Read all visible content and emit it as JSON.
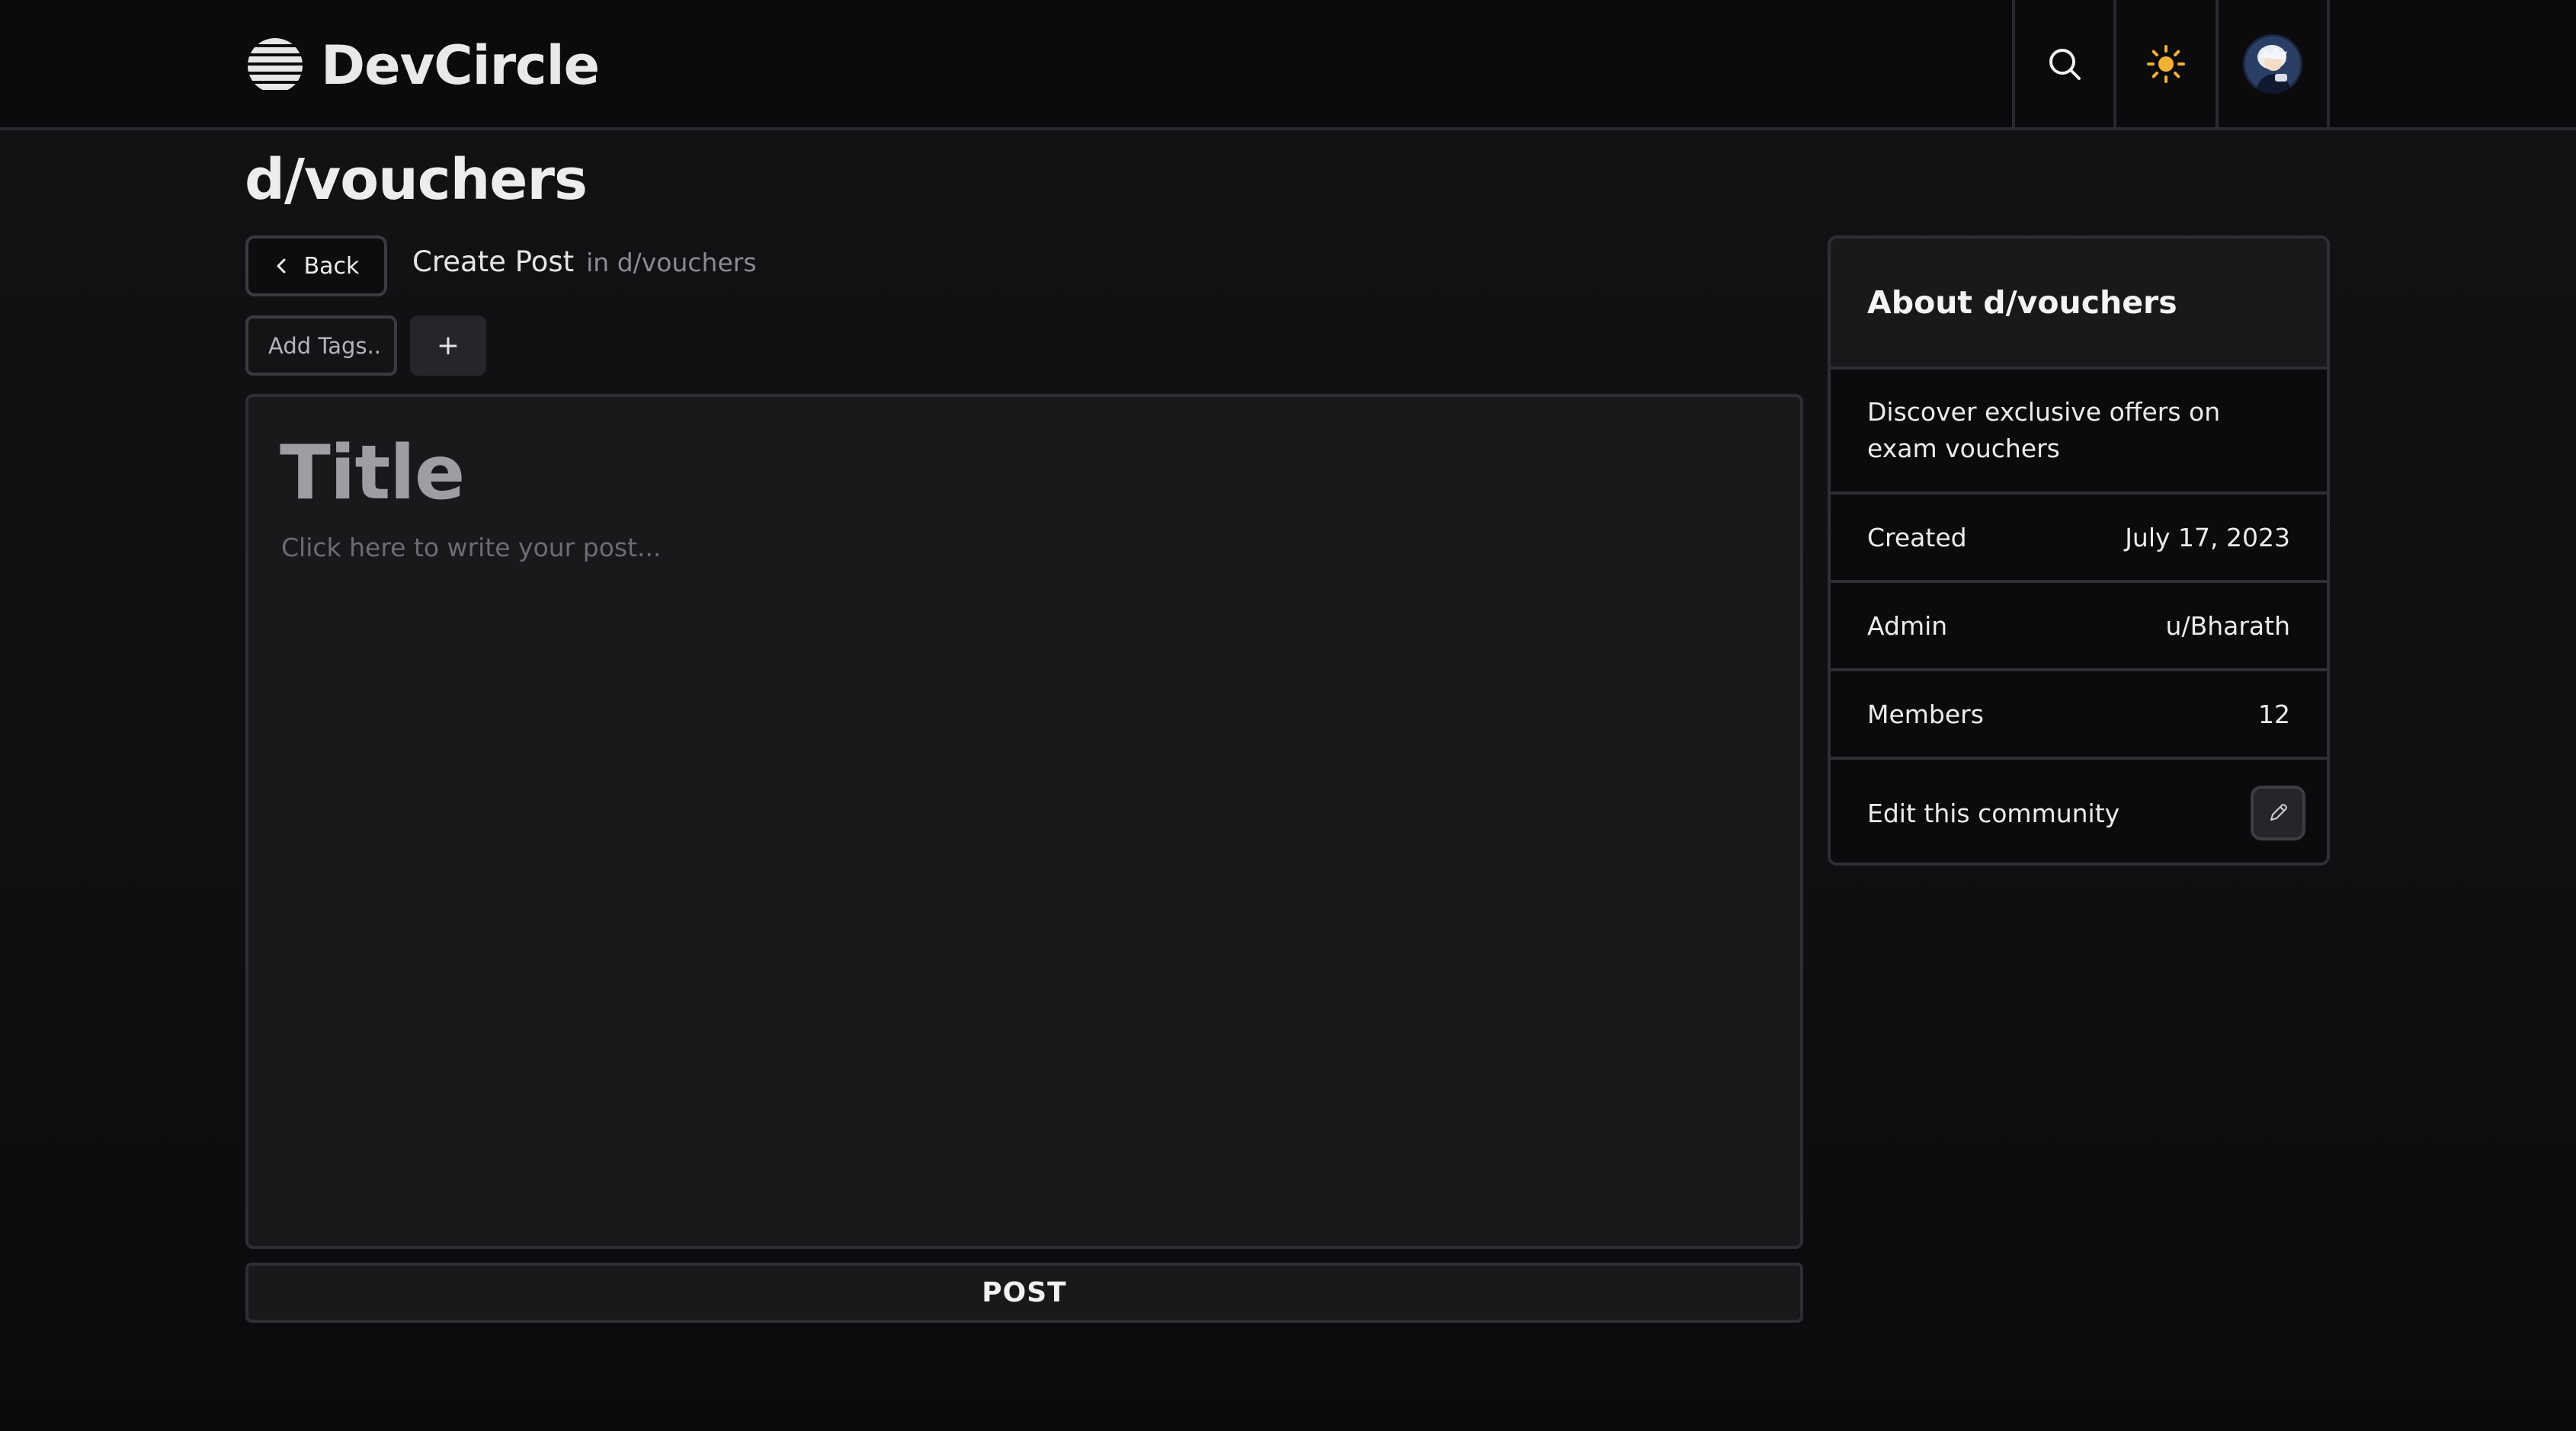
{
  "app": {
    "name": "DevCircle",
    "logo_icon": "striped-globe-icon"
  },
  "header": {
    "search_icon": "search-icon",
    "theme_icon": "sun-icon",
    "avatar_icon": "user-avatar"
  },
  "page": {
    "title": "d/vouchers"
  },
  "create": {
    "back_label": "Back",
    "heading": "Create Post",
    "community_context": "in d/vouchers"
  },
  "tags": {
    "placeholder": "Add Tags..",
    "add_label": "+"
  },
  "editor": {
    "title_placeholder": "Title",
    "body_placeholder": "Click here to write your post..."
  },
  "submit": {
    "label": "POST"
  },
  "about": {
    "heading": "About d/vouchers",
    "description": "Discover exclusive offers on exam vouchers",
    "rows": [
      {
        "label": "Created",
        "value": "July 17, 2023"
      },
      {
        "label": "Admin",
        "value": "u/Bharath"
      },
      {
        "label": "Members",
        "value": "12"
      }
    ],
    "edit_label": "Edit this community"
  },
  "colors": {
    "background": "#0f0f11",
    "panel": "#19191c",
    "border": "#2e2e33",
    "sun_accent": "#f2b233",
    "text_primary": "#ececee",
    "text_muted": "#8b8b90"
  }
}
